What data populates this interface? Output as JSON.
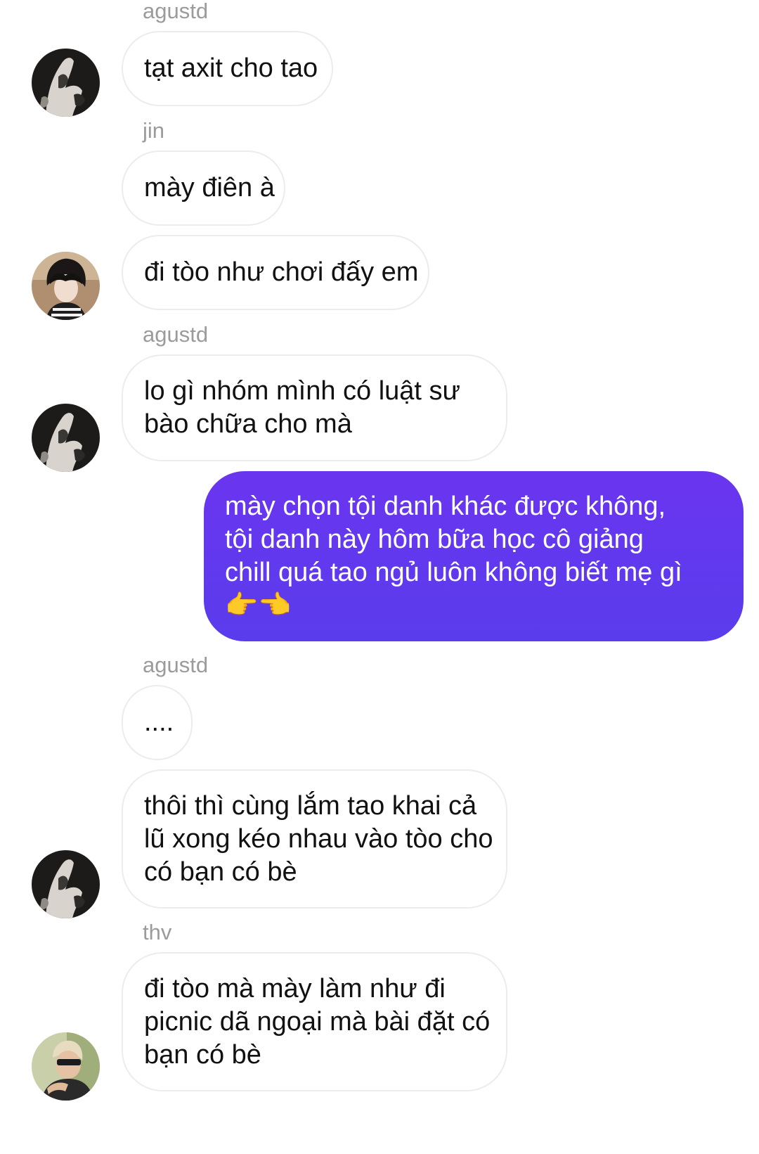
{
  "messages": [
    {
      "sender": "agustd",
      "text": [
        "tạt axit cho tao"
      ]
    },
    {
      "sender": "jin",
      "text": [
        "mày điên à"
      ]
    },
    {
      "text": [
        "đi tòo như chơi đấy em"
      ]
    },
    {
      "sender": "agustd",
      "text": [
        "lo gì nhóm mình có luật sư",
        "bào chữa cho mà"
      ]
    },
    {
      "text": [
        "mày chọn tội danh khác được không,",
        "tội danh này hôm bữa học cô giảng",
        "chill quá tao ngủ luôn không biết mẹ gì"
      ],
      "emoji": "👉👈"
    },
    {
      "sender": "agustd",
      "text": [
        "...."
      ]
    },
    {
      "text": [
        "thôi thì cùng lắm tao khai cả",
        "lũ xong kéo nhau vào tòo cho",
        "có bạn có bè"
      ]
    },
    {
      "sender": "thv",
      "text": [
        "đi tòo mà mày làm như đi",
        "picnic dã ngoại mà bài đặt có",
        "bạn có bè"
      ]
    }
  ],
  "colors": {
    "outgoing_bubble": "#6236ee",
    "incoming_bubble_border": "#ececec",
    "sender_label": "#9b9b9b"
  },
  "avatars": [
    "agustd-avatar",
    "jin-avatar",
    "agustd-avatar",
    "agustd-avatar",
    "thv-avatar"
  ]
}
